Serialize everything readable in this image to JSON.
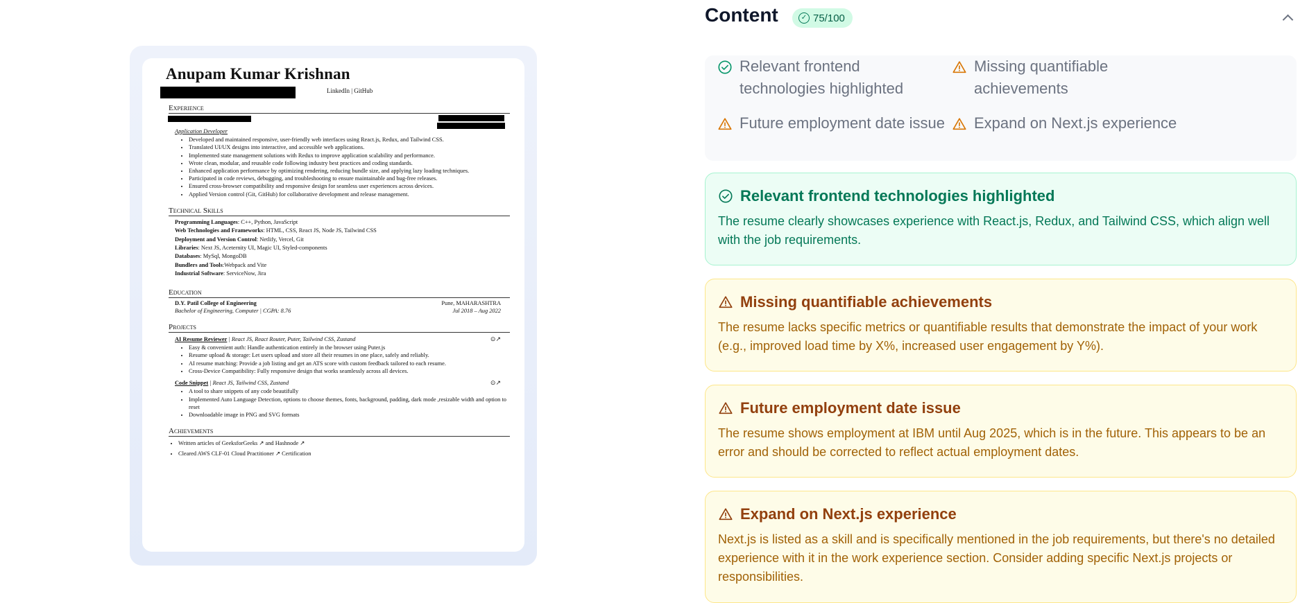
{
  "resume": {
    "name": "Anupam Kumar Krishnan",
    "contact_links": "LinkedIn | GitHub",
    "sections": {
      "experience": "Experience",
      "skills": "Technical Skills",
      "education": "Education",
      "projects": "Projects",
      "achievements": "Achievements"
    },
    "experience": {
      "role": "Application Developer",
      "bullets": [
        "Developed and maintained responsive, user-friendly web interfaces using React.js, Redux, and Tailwind CSS.",
        "Translated UI/UX designs into interactive, and accessible web applications.",
        "Implemented state management solutions with Redux to improve application scalability and performance.",
        "Wrote clean, modular, and reusable code following industry best practices and coding standards.",
        "Enhanced application performance by optimizing rendering, reducing bundle size, and applying lazy loading techniques.",
        "Participated in code reviews, debugging, and troubleshooting to ensure maintainable and bug-free releases.",
        "Ensured cross-browser compatibility and responsive design for seamless user experiences across devices.",
        "Applied Version control (Git, GitHub) for collaborative development and release management."
      ]
    },
    "skills": [
      {
        "label": "Programming Languages",
        "value": ": C++, Python, JavaScript"
      },
      {
        "label": "Web Technologies and Frameworks",
        "value": ": HTML, CSS, React JS, Node JS, Tailwind CSS"
      },
      {
        "label": "Deployment and Version Control",
        "value": ": Netlify, Vercel, Git"
      },
      {
        "label": "Libraries",
        "value": ": Next JS, Aceternity UI, Magic UI, Styled-components"
      },
      {
        "label": "Databases",
        "value": ": MySql, MongoDB"
      },
      {
        "label": "Bundlers and Tools",
        "value": ":Webpack and Vite"
      },
      {
        "label": "Industrial Software",
        "value": ": ServiceNow, Jira"
      }
    ],
    "education": {
      "school": "D.Y. Patil College of Engineering",
      "location": "Pune, MAHARASHTRA",
      "degree": "Bachelor of Engineering, Computer | CGPA: 8.76",
      "dates": "Jul 2018 – Aug 2022"
    },
    "projects": [
      {
        "name": "AI Resume Reviewer",
        "tech": "| React JS, React Router, Puter, Tailwind CSS, Zustand",
        "bullets": [
          "Easy & convenient auth: Handle authentication entirely in the browser using Puter.js",
          "Resume upload & storage: Let users upload and store all their resumes in one place, safely and reliably.",
          "AI resume matching: Provide a job listing and get an ATS score with custom feedback tailored to each resume.",
          "Cross-Device Compatibility: Fully responsive design that works seamlessly across all devices."
        ]
      },
      {
        "name": "Code Snippet",
        "tech": "| React JS, Tailwind CSS, Zustand",
        "bullets": [
          "A tool to share snippets of any code beautifully",
          "Implemented Auto Language Detection, options to choose themes, fonts, background, padding, dark mode ,resizable width and option to reset",
          "Downloadable image in PNG and SVG formats"
        ]
      }
    ],
    "achievements": [
      "Written articles of GeeksforGeeks ↗ and Hashnode ↗",
      "Cleared AWS CLF-01 Cloud Practitioner ↗ Certification"
    ]
  },
  "panel": {
    "title": "Content",
    "score": "75/100",
    "summary": [
      {
        "text": "Relevant frontend technologies highlighted",
        "status": "good"
      },
      {
        "text": "Missing quantifiable achievements",
        "status": "warn"
      },
      {
        "text": "Future employment date issue",
        "status": "warn"
      },
      {
        "text": "Expand on Next.js experience",
        "status": "warn"
      }
    ],
    "cards": [
      {
        "title": "Relevant frontend technologies highlighted",
        "text": "The resume clearly showcases experience with React.js, Redux, and Tailwind CSS, which align well with the job requirements.",
        "status": "good"
      },
      {
        "title": "Missing quantifiable achievements",
        "text": "The resume lacks specific metrics or quantifiable results that demonstrate the impact of your work (e.g., improved load time by X%, increased user engagement by Y%).",
        "status": "warn"
      },
      {
        "title": "Future employment date issue",
        "text": "The resume shows employment at IBM until Aug 2025, which is in the future. This appears to be an error and should be corrected to reflect actual employment dates.",
        "status": "warn"
      },
      {
        "title": "Expand on Next.js experience",
        "text": "Next.js is listed as a skill and is specifically mentioned in the job requirements, but there's no detailed experience with it in the work experience section. Consider adding specific Next.js projects or responsibilities.",
        "status": "warn"
      }
    ],
    "colors": {
      "good": "#059669",
      "warn": "#d97706"
    }
  }
}
